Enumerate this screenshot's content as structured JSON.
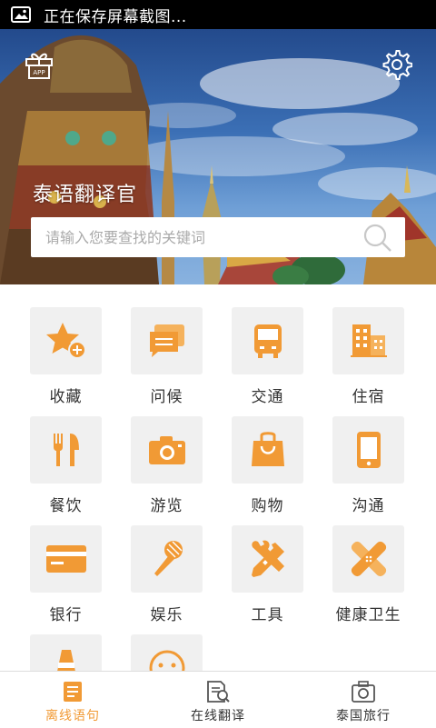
{
  "status_bar": {
    "notification_text": "正在保存屏幕截图...",
    "icon": "image-icon"
  },
  "header": {
    "title": "泰语翻译官",
    "gift_icon": "gift-icon",
    "gift_text": "APP",
    "settings_icon": "gear-icon"
  },
  "search": {
    "placeholder": "请输入您要查找的关键词",
    "value": ""
  },
  "categories": [
    {
      "label": "收藏",
      "icon": "star-add-icon"
    },
    {
      "label": "问候",
      "icon": "chat-icon"
    },
    {
      "label": "交通",
      "icon": "bus-icon"
    },
    {
      "label": "住宿",
      "icon": "building-icon"
    },
    {
      "label": "餐饮",
      "icon": "fork-knife-icon"
    },
    {
      "label": "游览",
      "icon": "camera-icon"
    },
    {
      "label": "购物",
      "icon": "shopping-bag-icon"
    },
    {
      "label": "沟通",
      "icon": "phone-icon"
    },
    {
      "label": "银行",
      "icon": "bank-card-icon"
    },
    {
      "label": "娱乐",
      "icon": "microphone-icon"
    },
    {
      "label": "工具",
      "icon": "tools-icon"
    },
    {
      "label": "健康卫生",
      "icon": "bandage-icon"
    },
    {
      "label": "",
      "icon": "cone-icon"
    },
    {
      "label": "",
      "icon": "face-icon"
    }
  ],
  "tabs": [
    {
      "label": "离线语句",
      "icon": "offline-phrases-icon",
      "active": true
    },
    {
      "label": "在线翻译",
      "icon": "online-translate-icon",
      "active": false
    },
    {
      "label": "泰国旅行",
      "icon": "travel-camera-icon",
      "active": false
    }
  ],
  "colors": {
    "accent": "#f19a35",
    "tile_background": "#f0f0f0",
    "text": "#333333"
  }
}
